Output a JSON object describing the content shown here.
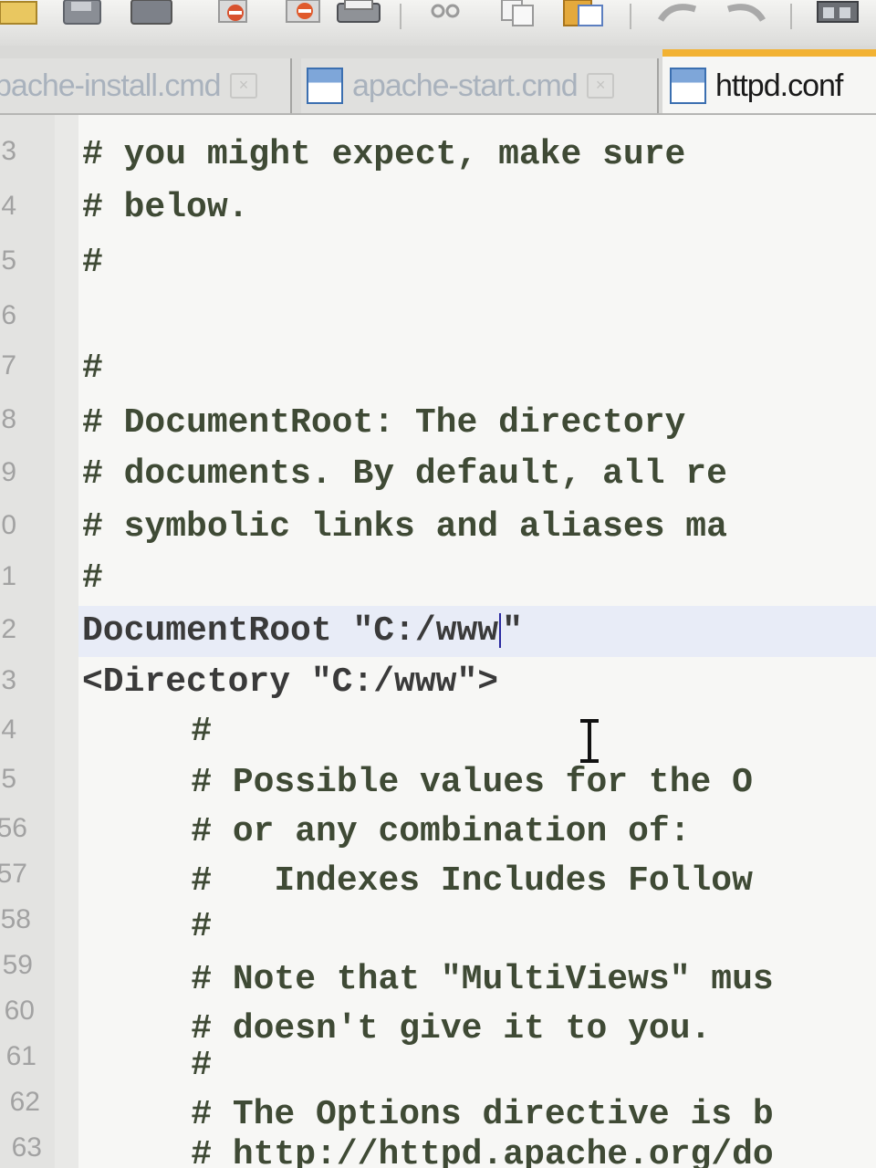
{
  "tabs": [
    {
      "label": "pache-install.cmd",
      "close": "×",
      "active": false
    },
    {
      "label": "apache-start.cmd",
      "close": "×",
      "active": false
    },
    {
      "label": "httpd.conf",
      "active": true
    }
  ],
  "toolbar": {
    "icons": [
      "folder-icon",
      "save-icon",
      "save-all-icon",
      "close-icon",
      "close-all-icon",
      "print-icon",
      "cut-icon",
      "copy-icon",
      "paste-icon",
      "undo-icon",
      "redo-icon",
      "view-icon"
    ]
  },
  "editor": {
    "lines": [
      {
        "num": "3",
        "text": "# you might expect, make sure"
      },
      {
        "num": "4",
        "text": "# below."
      },
      {
        "num": "5",
        "text": "#"
      },
      {
        "num": "6",
        "text": ""
      },
      {
        "num": "7",
        "text": "#"
      },
      {
        "num": "8",
        "text": "# DocumentRoot: The directory"
      },
      {
        "num": "9",
        "text": "# documents. By default, all re"
      },
      {
        "num": "0",
        "text": "# symbolic links and aliases ma"
      },
      {
        "num": "1",
        "text": "#"
      },
      {
        "num": "2",
        "text_before_caret": "DocumentRoot \"C:/www",
        "text_after_caret": "\"",
        "current": true
      },
      {
        "num": "3",
        "text": "<Directory \"C:/www\">"
      },
      {
        "num": "4",
        "text": "    #"
      },
      {
        "num": "5",
        "text": "    # Possible values for the O"
      },
      {
        "num": "56",
        "text": "    # or any combination of:"
      },
      {
        "num": "57",
        "text": "    #   Indexes Includes Follow"
      },
      {
        "num": "58",
        "text": "    #"
      },
      {
        "num": "59",
        "text": "    # Note that \"MultiViews\" mus"
      },
      {
        "num": "60",
        "text": "    # doesn't give it to you."
      },
      {
        "num": "61",
        "text": "    #"
      },
      {
        "num": "62",
        "text": "    # The Options directive is b"
      },
      {
        "num": "63",
        "text": "    # http://httpd.apache.org/do"
      }
    ]
  },
  "colors": {
    "active_tab_accent": "#f2b233",
    "current_line": "#e8ecf7",
    "caret": "#2a2aa0"
  }
}
